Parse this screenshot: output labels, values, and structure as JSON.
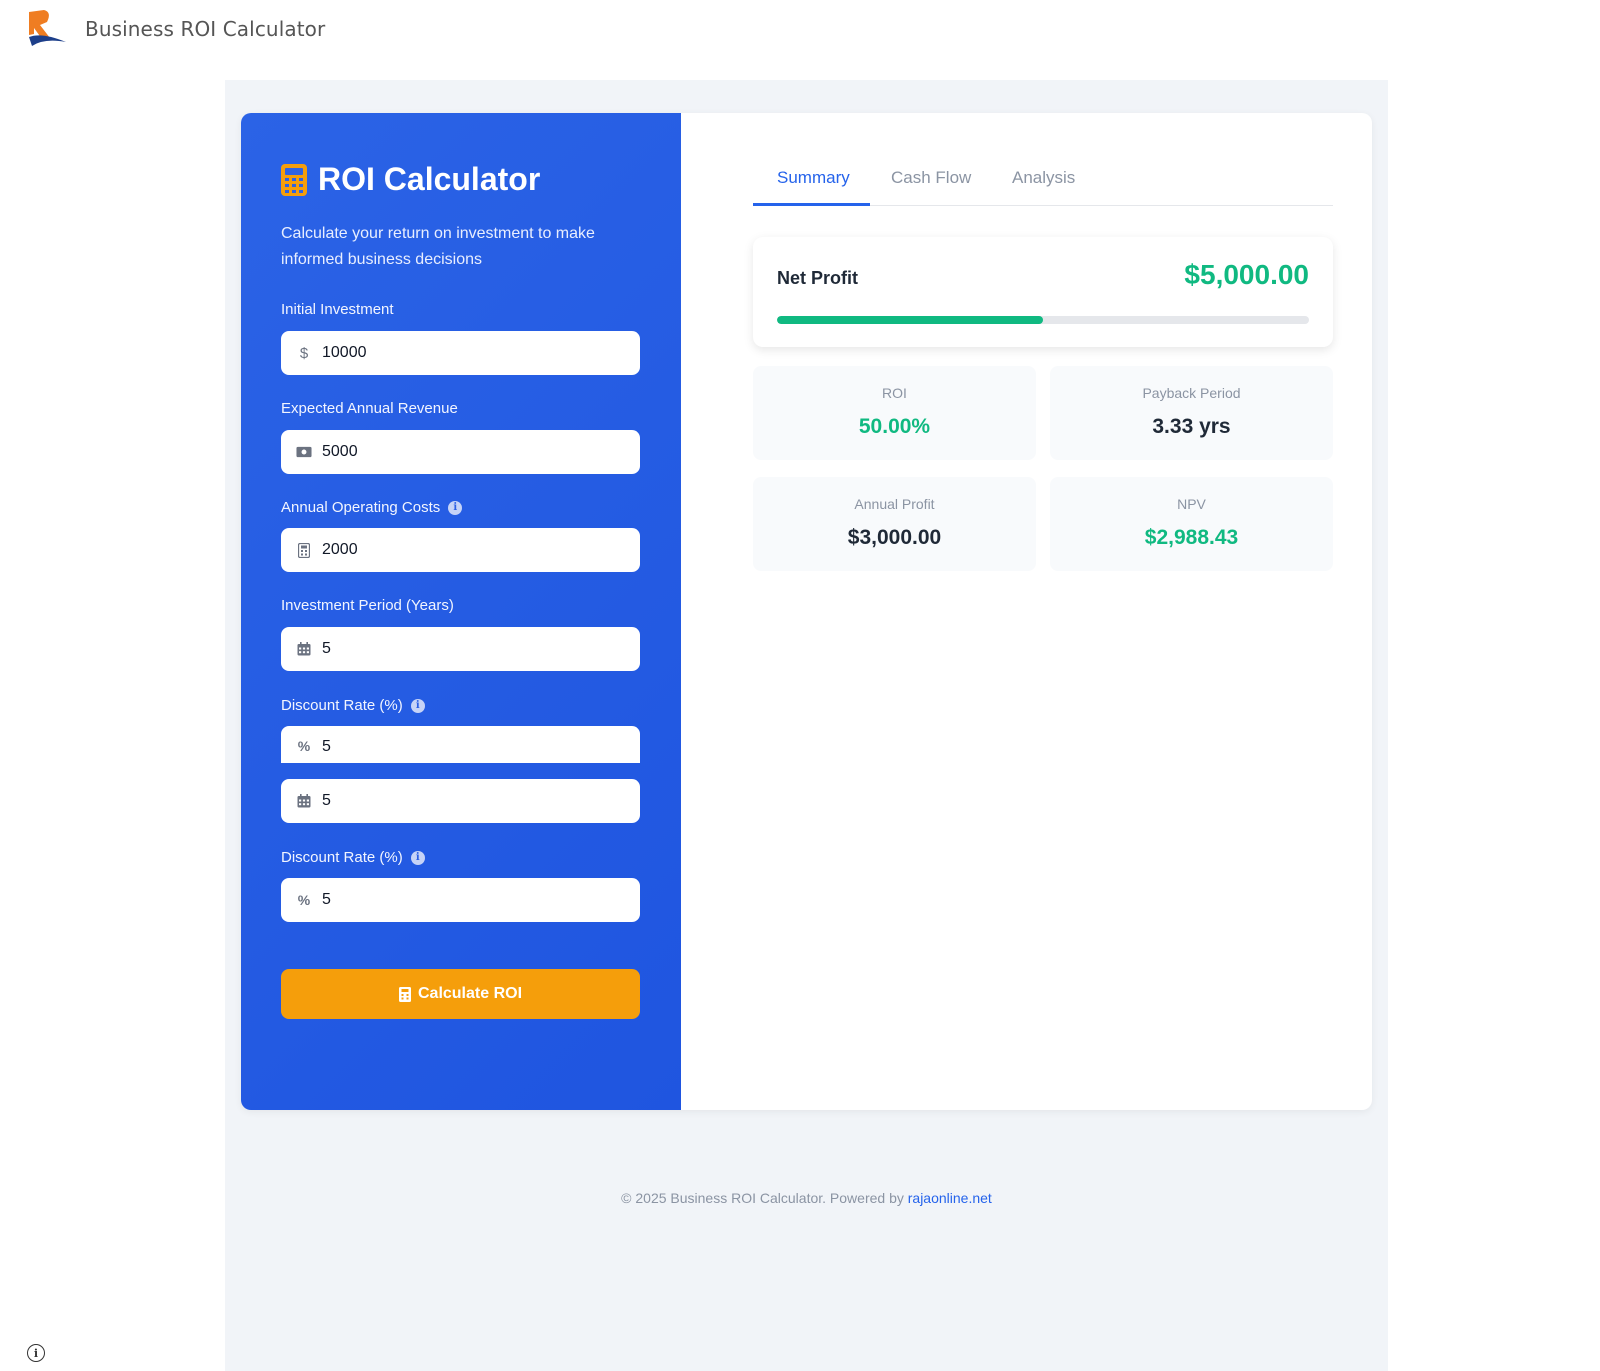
{
  "app": {
    "title": "Business ROI Calculator"
  },
  "calculator": {
    "title": "ROI Calculator",
    "subtitle": "Calculate your return on investment to make informed business decisions",
    "fields": [
      {
        "label": "Initial Investment",
        "icon": "dollar-icon",
        "value": "10000"
      },
      {
        "label": "Expected Annual Revenue",
        "icon": "money-bill-icon",
        "value": "5000"
      },
      {
        "label": "Annual Operating Costs",
        "icon": "calculator-icon",
        "value": "2000"
      },
      {
        "label": "Investment Period (Years)",
        "icon": "calendar-icon",
        "value": "5"
      },
      {
        "label": "Discount Rate (%)",
        "icon": "percent-icon",
        "value": "5"
      },
      {
        "label": "Investment Period (Years)",
        "icon": "calendar-icon",
        "value": "5"
      },
      {
        "label": "Discount Rate (%)",
        "icon": "percent-icon",
        "value": "5"
      }
    ],
    "button_label": "Calculate ROI"
  },
  "tabs": [
    {
      "label": "Summary",
      "active": true
    },
    {
      "label": "Cash Flow",
      "active": false
    },
    {
      "label": "Analysis",
      "active": false
    }
  ],
  "summary": {
    "net_profit_label": "Net Profit",
    "net_profit_value": "$5,000.00",
    "net_profit_progress": 0.5,
    "metrics": [
      {
        "label": "ROI",
        "value": "50.00%",
        "color": "green"
      },
      {
        "label": "Payback Period",
        "value": "3.33 yrs",
        "color": "dark"
      },
      {
        "label": "Annual Profit",
        "value": "$3,000.00",
        "color": "dark"
      },
      {
        "label": "NPV",
        "value": "$2,988.43",
        "color": "green"
      }
    ]
  },
  "footer": {
    "text": "© 2025 Business ROI Calculator. Powered by",
    "link_text": "rajaonline.net"
  },
  "colors": {
    "primary": "#2563eb",
    "accent": "#f59e0b",
    "success": "#10b981"
  }
}
